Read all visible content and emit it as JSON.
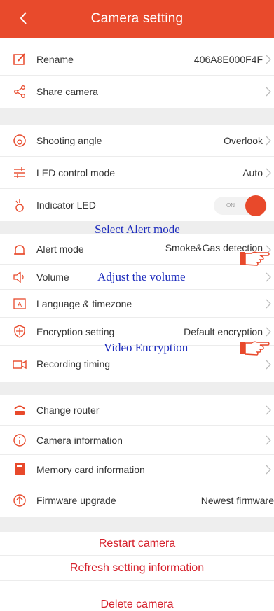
{
  "header": {
    "title": "Camera setting"
  },
  "rows": {
    "rename": {
      "label": "Rename",
      "value": "406A8E000F4F"
    },
    "share": {
      "label": "Share camera"
    },
    "shooting_angle": {
      "label": "Shooting angle",
      "value": "Overlook"
    },
    "led_control": {
      "label": "LED control mode",
      "value": "Auto"
    },
    "indicator_led": {
      "label": "Indicator LED",
      "toggle_text": "ON",
      "toggle_on": true
    },
    "alert_mode": {
      "label": "Alert mode",
      "value": "Smoke&Gas detection"
    },
    "volume": {
      "label": "Volume"
    },
    "language": {
      "label": "Language & timezone"
    },
    "encryption": {
      "label": "Encryption setting",
      "value": "Default encryption"
    },
    "recording": {
      "label": "Recording timing"
    },
    "change_router": {
      "label": "Change router"
    },
    "camera_info": {
      "label": "Camera information"
    },
    "memory_card": {
      "label": "Memory card information"
    },
    "firmware": {
      "label": "Firmware upgrade",
      "value": "Newest firmware"
    }
  },
  "annotations": {
    "alert": "Select Alert mode",
    "volume": "Adjust the volume",
    "encryption": "Video Encryption"
  },
  "actions": {
    "restart": "Restart camera",
    "refresh": "Refresh setting information",
    "delete": "Delete camera"
  },
  "colors": {
    "accent": "#e84a2c",
    "annotation": "#1c2bbd",
    "danger": "#d6202b"
  }
}
